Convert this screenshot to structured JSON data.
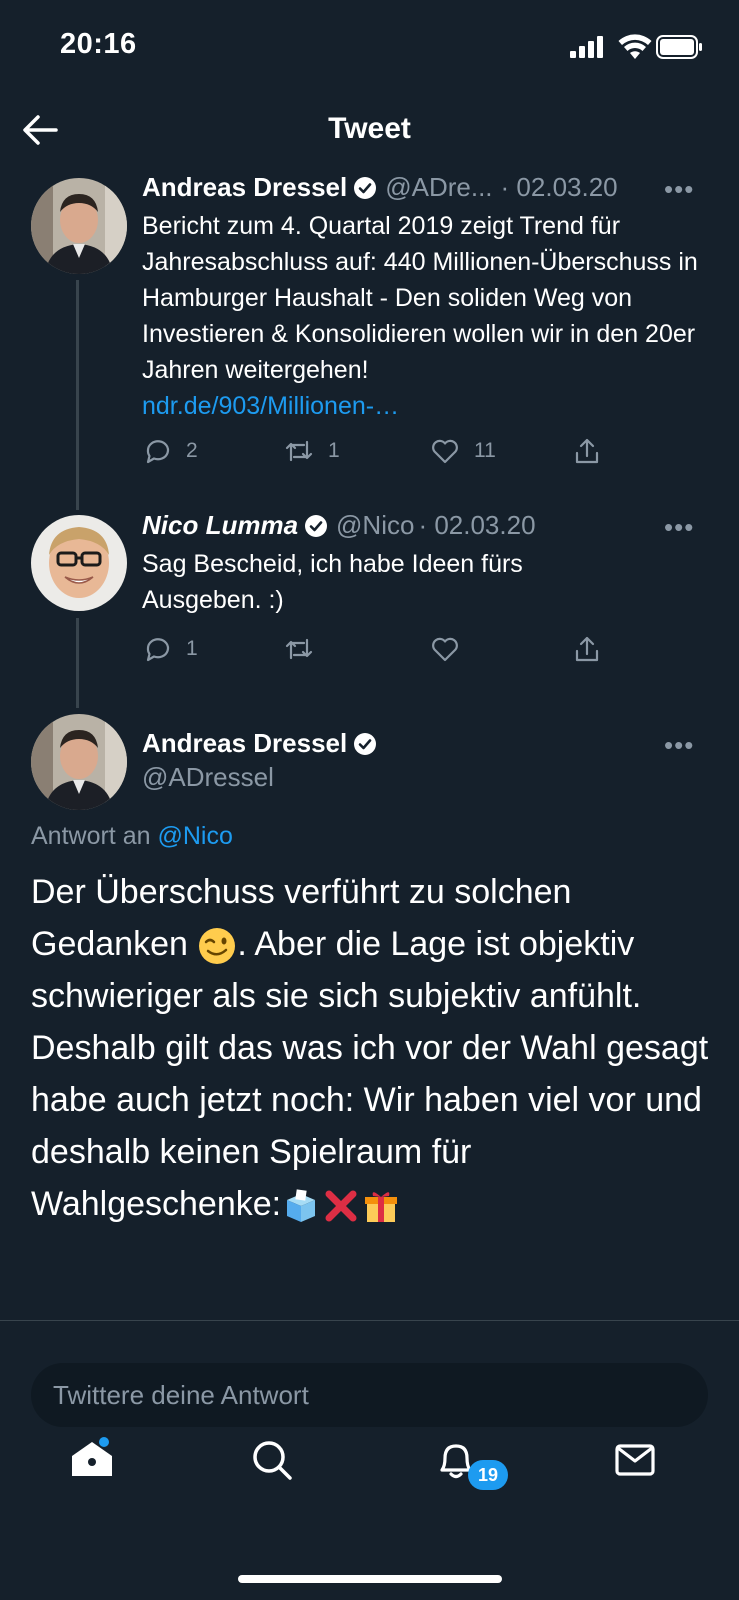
{
  "status_bar": {
    "time": "20:16"
  },
  "header": {
    "title": "Tweet"
  },
  "thread": [
    {
      "name": "Andreas Dressel",
      "handle": "@ADre...",
      "date": "· 02.03.20",
      "text": "Bericht zum 4. Quartal 2019 zeigt Trend für Jahresabschluss auf: 440 Millionen-Überschuss in Hamburger Haushalt - Den soliden Weg von Investieren & Konsolidieren wollen wir in den 20er Jahren weitergehen!",
      "link": "ndr.de/903/Millionen-…",
      "replies": "2",
      "retweets": "1",
      "likes": "11"
    },
    {
      "name": "Nico Lumma",
      "handle": "@Nico",
      "date": "· 02.03.20",
      "text": "Sag Bescheid, ich habe Ideen fürs Ausgeben. :)",
      "replies": "1",
      "retweets": "",
      "likes": ""
    }
  ],
  "main_tweet": {
    "name": "Andreas Dressel",
    "handle": "@ADressel",
    "reply_to_label": "Antwort an",
    "reply_to_handle": "@Nico",
    "text_part1": "Der Überschuss verführt zu solchen Gedanken ",
    "emoji_wink": "😉",
    "text_part2": ". Aber die Lage ist objektiv schwieriger als sie sich subjektiv anfühlt. Deshalb gilt das was ich vor der Wahl gesagt habe auch jetzt noch: Wir haben viel vor und deshalb keinen Spielraum für Wahlgeschenke:",
    "emojis": [
      "ballot-box",
      "cross-mark",
      "gift"
    ]
  },
  "more_label": "•••",
  "reply_box": {
    "placeholder": "Twittere deine Antwort"
  },
  "tab_bar": {
    "notifications_badge": "19"
  },
  "colors": {
    "background": "#15202b",
    "accent": "#1d9bf0",
    "muted": "#8b98a5"
  }
}
